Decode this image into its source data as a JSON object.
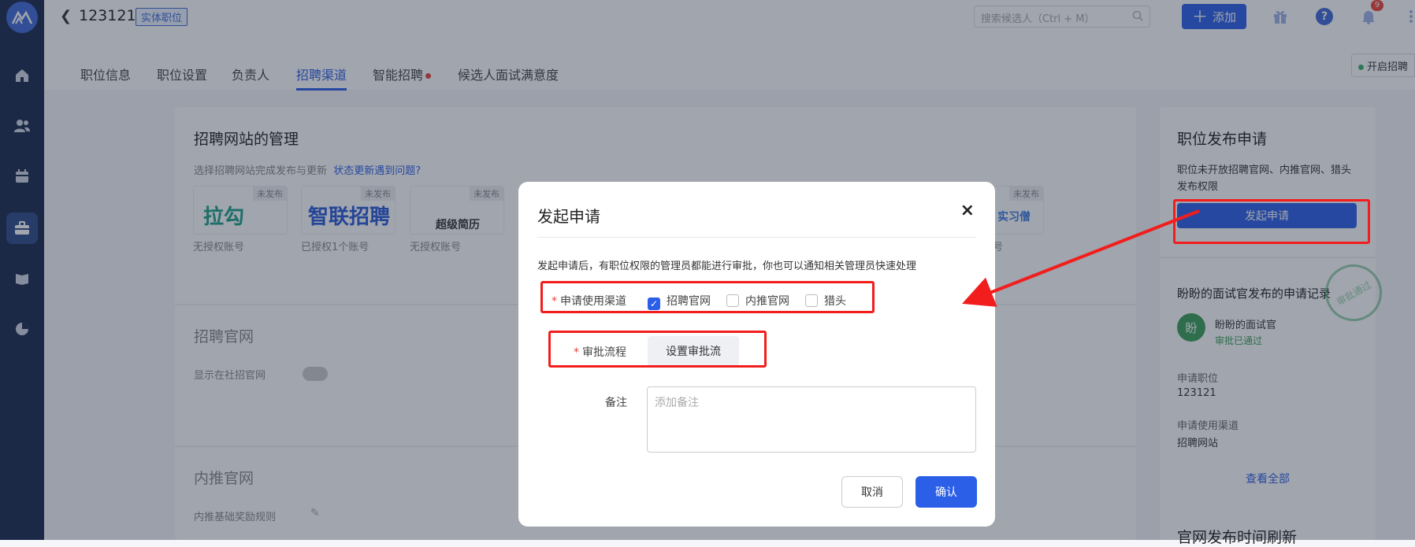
{
  "header": {
    "job_id": "123121",
    "job_tag": "实体职位",
    "search_placeholder": "搜索候选人（Ctrl + M）",
    "add_label": "添加",
    "notification_count": "9"
  },
  "tabs": [
    {
      "label": "职位信息"
    },
    {
      "label": "职位设置"
    },
    {
      "label": "负责人"
    },
    {
      "label": "招聘渠道"
    },
    {
      "label": "智能招聘"
    },
    {
      "label": "候选人面试满意度"
    }
  ],
  "open_button": "开启招聘",
  "main": {
    "site_title": "招聘网站的管理",
    "site_sub": "选择招聘网站完成发布与更新",
    "site_link": "状态更新遇到问题?",
    "sites": [
      {
        "name": "拉勾",
        "tag": "未发布",
        "caption": "无授权账号"
      },
      {
        "name": "智联招聘",
        "tag": "未发布",
        "caption": "已授权1个账号"
      },
      {
        "name": "超级简历",
        "tag": "未发布",
        "caption": "无授权账号"
      },
      {
        "name": "实习僧",
        "tag": "未发布",
        "caption": "号"
      }
    ],
    "official_title": "招聘官网",
    "official_row": "显示在社招官网",
    "internal_title": "内推官网",
    "internal_row": "内推基础奖励规则"
  },
  "right": {
    "title": "职位发布申请",
    "desc": "职位未开放招聘官网、内推官网、猎头发布权限",
    "apply_btn": "发起申请",
    "record_title": "盼盼的面试官发布的申请记录",
    "avatar": "盼",
    "reviewer": "盼盼的面试官",
    "status": "审批已通过",
    "stamp": "审批通过",
    "f1_label": "申请职位",
    "f1_value": "123121",
    "f2_label": "申请使用渠道",
    "f2_value": "招聘网站",
    "view_all": "查看全部",
    "bottom": "官网发布时间刷新"
  },
  "modal": {
    "title": "发起申请",
    "close": "×",
    "desc": "发起申请后，有职位权限的管理员都能进行审批，你也可以通知相关管理员快速处理",
    "channel_label": "申请使用渠道",
    "channels": [
      {
        "label": "招聘官网",
        "checked": true
      },
      {
        "label": "内推官网",
        "checked": false
      },
      {
        "label": "猎头",
        "checked": false
      }
    ],
    "flow_label": "审批流程",
    "flow_button": "设置审批流",
    "memo_label": "备注",
    "memo_placeholder": "添加备注",
    "cancel": "取消",
    "confirm": "确认"
  },
  "colors": {
    "accent": "#2b5fe8",
    "sidebar": "#1b2a4e",
    "annotation": "#f21d1d"
  }
}
